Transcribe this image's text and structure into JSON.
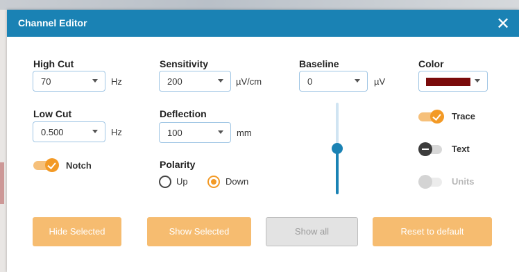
{
  "dialog": {
    "title": "Channel Editor",
    "close_glyph": "✕"
  },
  "high_cut": {
    "label": "High Cut",
    "value": "70",
    "unit": "Hz"
  },
  "low_cut": {
    "label": "Low Cut",
    "value": "0.500",
    "unit": "Hz"
  },
  "notch": {
    "label": "Notch",
    "state": "on"
  },
  "sensitivity": {
    "label": "Sensitivity",
    "value": "200",
    "unit": "µV/cm"
  },
  "deflection": {
    "label": "Deflection",
    "value": "100",
    "unit": "mm"
  },
  "polarity": {
    "label": "Polarity",
    "options": [
      {
        "label": "Up",
        "selected": false
      },
      {
        "label": "Down",
        "selected": true
      }
    ]
  },
  "baseline": {
    "label": "Baseline",
    "value": "0",
    "unit": "µV",
    "slider_level": 0.5
  },
  "color": {
    "label": "Color",
    "value": "#7a0b0b"
  },
  "toggles": [
    {
      "label": "Trace",
      "state": "on"
    },
    {
      "label": "Text",
      "state": "off"
    },
    {
      "label": "Units",
      "state": "disabled"
    }
  ],
  "buttons": {
    "hide_selected": "Hide Selected",
    "show_selected": "Show Selected",
    "show_all": "Show all",
    "reset_default": "Reset to default"
  },
  "colors": {
    "title_bar": "#1a82b4",
    "accent": "#f39a26",
    "button": "#f6bc70"
  }
}
